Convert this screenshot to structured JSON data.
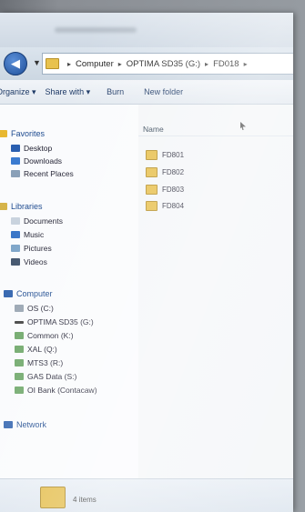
{
  "address": {
    "crumbs": [
      "Computer",
      "OPTIMA SD35 (G:)",
      "FD018"
    ]
  },
  "toolbar": {
    "organize": "Organize ▾",
    "share": "Share with ▾",
    "burn": "Burn",
    "new_folder": "New folder"
  },
  "nav": {
    "favorites": "Favorites",
    "desktop": "Desktop",
    "downloads": "Downloads",
    "recent": "Recent Places",
    "libraries": "Libraries",
    "documents": "Documents",
    "music": "Music",
    "pictures": "Pictures",
    "videos": "Videos",
    "computer": "Computer",
    "drives": [
      "OS (C:)",
      "OPTIMA SD35 (G:)",
      "Common (K:)",
      "XAL (Q:)",
      "MTS3 (R:)",
      "GAS Data (S:)",
      "OI Bank (Contacaw)"
    ],
    "network": "Network"
  },
  "content": {
    "col_name": "Name",
    "folders": [
      "FD801",
      "FD802",
      "FD803",
      "FD804"
    ]
  },
  "status": {
    "text": "4 items"
  },
  "colors": {
    "folder": "#e6bd45",
    "link": "#1d4a8f"
  }
}
